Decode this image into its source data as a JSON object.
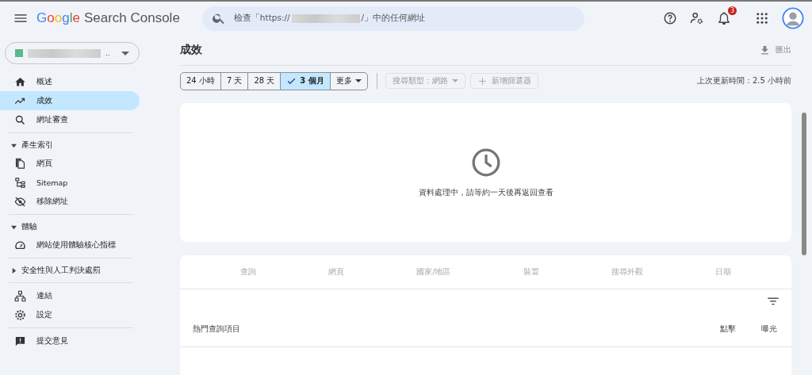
{
  "app": {
    "logo": "Google",
    "product": "Search Console"
  },
  "search": {
    "placeholder_start": "檢查「https://",
    "placeholder_end": "/」中的任何網址"
  },
  "notifications": {
    "count": "3"
  },
  "property": {
    "name_end": ".."
  },
  "sidebar": {
    "items": [
      {
        "kind": "link",
        "label": "概述",
        "selected": false
      },
      {
        "kind": "link",
        "label": "成效",
        "selected": true
      },
      {
        "kind": "link",
        "label": "網址審查",
        "selected": false
      },
      {
        "kind": "divider"
      },
      {
        "kind": "section",
        "label": "產生索引",
        "expanded": true
      },
      {
        "kind": "link",
        "label": "網頁",
        "selected": false
      },
      {
        "kind": "link",
        "label": "Sitemap",
        "selected": false
      },
      {
        "kind": "link",
        "label": "移除網址",
        "selected": false
      },
      {
        "kind": "divider"
      },
      {
        "kind": "section",
        "label": "體驗",
        "expanded": true
      },
      {
        "kind": "link",
        "label": "網站使用體驗核心指標",
        "selected": false
      },
      {
        "kind": "divider"
      },
      {
        "kind": "section",
        "label": "安全性與人工判決處罰",
        "expanded": false
      },
      {
        "kind": "divider"
      },
      {
        "kind": "link",
        "label": "連結",
        "selected": false
      },
      {
        "kind": "link",
        "label": "設定",
        "selected": false
      },
      {
        "kind": "divider"
      },
      {
        "kind": "link",
        "label": "提交意見",
        "selected": false
      }
    ]
  },
  "page": {
    "title": "成效",
    "export": "匯出"
  },
  "date_ranges": [
    {
      "kind": "range",
      "label": "24 小時",
      "selected": false
    },
    {
      "kind": "range",
      "label": "7 天",
      "selected": false
    },
    {
      "kind": "range",
      "label": "28 天",
      "selected": false
    },
    {
      "kind": "range",
      "label": "3 個月",
      "selected": true
    },
    {
      "kind": "menu",
      "label": "更多",
      "selected": false
    }
  ],
  "filters": [
    {
      "label": "搜尋類型：網路",
      "kind": "dropdown"
    },
    {
      "label": "新增篩選器",
      "kind": "add"
    }
  ],
  "last_updated": "上次更新時間：2.5 小時前",
  "status_card": {
    "message": "資料處理中，請等約一天後再返回查看"
  },
  "dimension_tabs": [
    "查詢",
    "網頁",
    "國家/地區",
    "裝置",
    "搜尋外觀",
    "日期"
  ],
  "table": {
    "columns": [
      "熱門查詢項目",
      "點擊",
      "曝光"
    ]
  }
}
